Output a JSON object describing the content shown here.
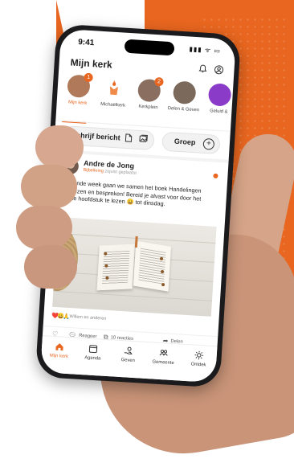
{
  "status_bar": {
    "time": "9:41",
    "icons": "▮▮▮ ᯤ ▭"
  },
  "header": {
    "title": "Mijn kerk",
    "bell_icon": "bell-icon",
    "profile_icon": "user-circle-icon"
  },
  "stories": [
    {
      "label": "Mijn kerk",
      "badge": "1",
      "active": true,
      "color": "#b07a5a"
    },
    {
      "label": "Michaëlkerk",
      "badge": "",
      "active": false,
      "color": "#f08a4b"
    },
    {
      "label": "Kerkplein",
      "badge": "2",
      "active": false,
      "color": "#8a6f60"
    },
    {
      "label": "Delen & Geven",
      "badge": "",
      "active": false,
      "color": "#7b6a5c"
    },
    {
      "label": "Geluid &",
      "badge": "",
      "active": false,
      "color": "#8a3cc8"
    }
  ],
  "composer": {
    "write_label": "Schrijf bericht",
    "group_label": "Groep"
  },
  "post": {
    "author": "Andre de Jong",
    "group": "Bijbelkring",
    "meta": "zojuist geplaatst",
    "text": "Komende week gaan we samen het boek Handelingen doorlezen en bespreken! Bereid je alvast voor door het eerste hoofdstuk te lezen 😀 tot dinsdag.",
    "reactions_text": "Willem en anderen",
    "actions": {
      "like": "",
      "comment": "Reageer",
      "reactions": "10 reacties",
      "share": "Delen"
    }
  },
  "tabbar": [
    {
      "label": "Mijn kerk",
      "icon": "home-icon",
      "active": true
    },
    {
      "label": "Agenda",
      "icon": "calendar-icon",
      "active": false
    },
    {
      "label": "Geven",
      "icon": "give-icon",
      "active": false
    },
    {
      "label": "Gemeente",
      "icon": "community-icon",
      "active": false
    },
    {
      "label": "Ontdek",
      "icon": "sun-icon",
      "active": false
    }
  ],
  "colors": {
    "accent": "#e8661f",
    "background_band": "#e8661f"
  }
}
